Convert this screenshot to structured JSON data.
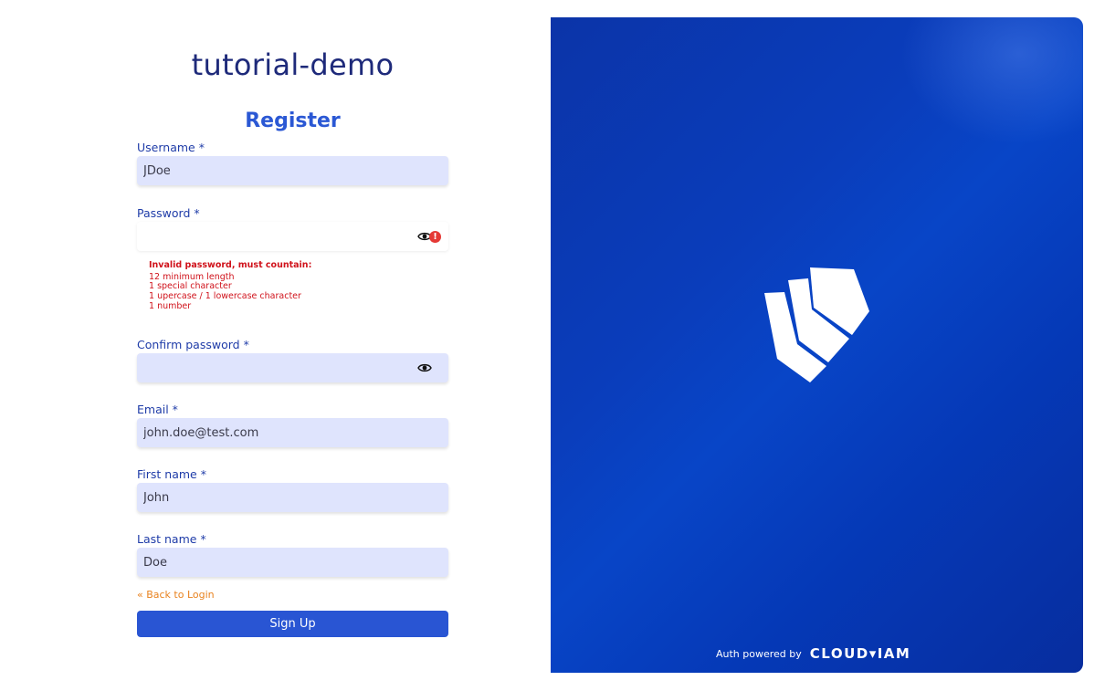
{
  "app": {
    "title": "tutorial-demo"
  },
  "form": {
    "title": "Register",
    "required_marker": "*",
    "fields": {
      "username": {
        "label": "Username",
        "value": "JDoe"
      },
      "password": {
        "label": "Password",
        "value": ""
      },
      "confirm_password": {
        "label": "Confirm password",
        "value": ""
      },
      "email": {
        "label": "Email",
        "value": "john.doe@test.com"
      },
      "first_name": {
        "label": "First name",
        "value": "John"
      },
      "last_name": {
        "label": "Last name",
        "value": "Doe"
      }
    },
    "password_error": {
      "heading": "Invalid password, must countain:",
      "rules": [
        "12 minimum length",
        "1 special character",
        "1 upercase / 1 lowercase character",
        "1 number"
      ]
    },
    "error_icon_glyph": "!",
    "back_link": "« Back to Login",
    "submit_label": "Sign Up"
  },
  "hero": {
    "powered_by": "Auth powered by",
    "brand": "CLOUD▾IAM"
  },
  "colors": {
    "primary": "#2955d3",
    "title": "#1e2a7a",
    "input_bg": "#dfe4fd",
    "error": "#d0121b",
    "link": "#e8821e",
    "hero": "#0a3dbb"
  },
  "icons": [
    "eye-icon",
    "error-icon",
    "shield-logo-icon"
  ]
}
